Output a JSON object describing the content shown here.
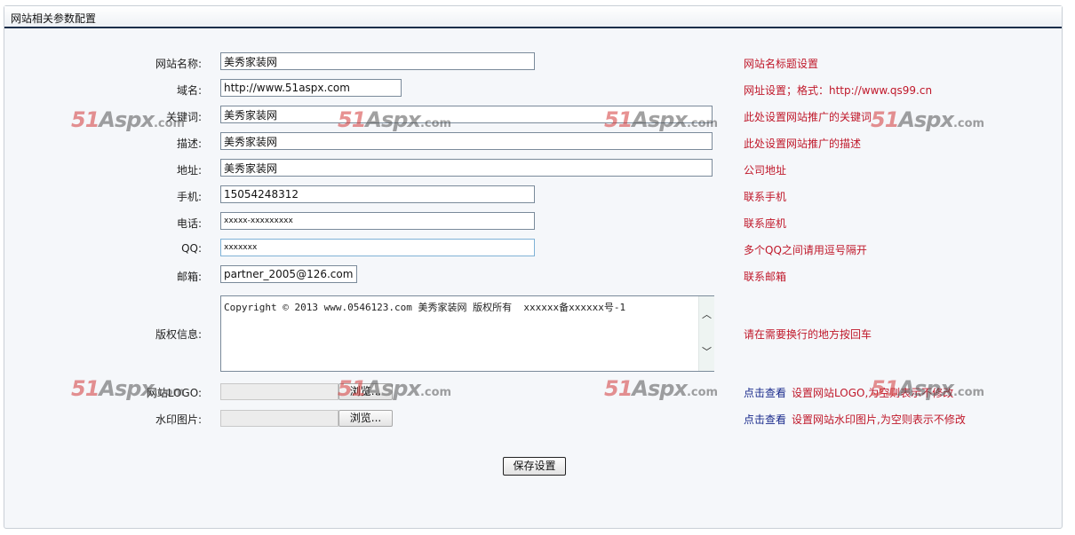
{
  "panel": {
    "title": "网站相关参数配置"
  },
  "fields": {
    "site_name": {
      "label": "网站名称:",
      "value": "美秀家装网",
      "hint": "网站名标题设置"
    },
    "domain": {
      "label": "域名:",
      "value": "http://www.51aspx.com",
      "hint": "网址设置；格式：http://www.qs99.cn"
    },
    "keywords": {
      "label": "关键词:",
      "value": "美秀家装网",
      "hint": "此处设置网站推广的关键词"
    },
    "description": {
      "label": "描述:",
      "value": "美秀家装网",
      "hint": "此处设置网站推广的描述"
    },
    "address": {
      "label": "地址:",
      "value": "美秀家装网",
      "hint": "公司地址"
    },
    "mobile": {
      "label": "手机:",
      "value": "15054248312",
      "hint": "联系手机"
    },
    "phone": {
      "label": "电话:",
      "value": "xxxxx-xxxxxxxxx",
      "hint": "联系座机"
    },
    "qq": {
      "label": "QQ:",
      "value": "xxxxxxx",
      "hint": "多个QQ之间请用逗号隔开"
    },
    "email": {
      "label": "邮箱:",
      "value": "partner_2005@126.com",
      "hint": "联系邮箱"
    },
    "copyright": {
      "label": "版权信息:",
      "value": "Copyright © 2013 www.0546123.com 美秀家装网 版权所有  xxxxxx备xxxxxx号-1",
      "hint": "请在需要换行的地方按回车"
    },
    "logo": {
      "label": "网站LOGO:",
      "browse": "浏览...",
      "view_link": "点击查看",
      "hint": "设置网站LOGO,为空则表示不修改"
    },
    "watermark": {
      "label": "水印图片:",
      "browse": "浏览...",
      "view_link": "点击查看",
      "hint": "设置网站水印图片,为空则表示不修改"
    }
  },
  "save_button": "保存设置",
  "watermark_logo": {
    "num": "51",
    "word": "Aspx",
    "suffix": ".com"
  },
  "colors": {
    "hint": "#c0182a",
    "link": "#1a2b8c",
    "header_line": "#1a2f4a"
  }
}
